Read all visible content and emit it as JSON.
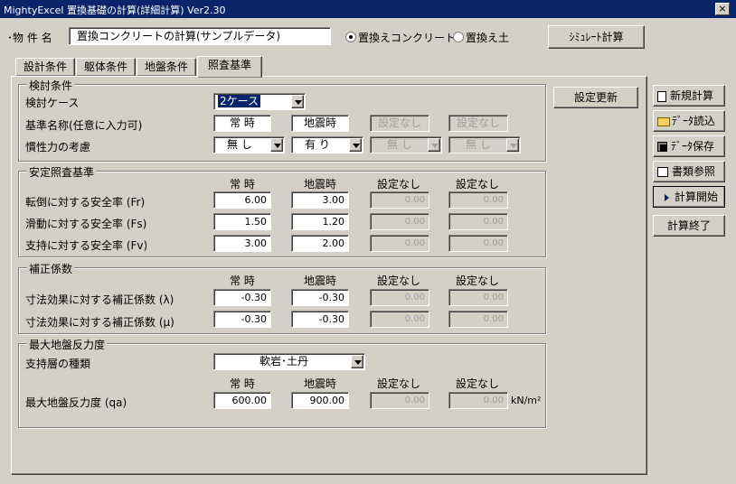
{
  "window": {
    "title": "MightyExcel 置換基礎の計算(詳細計算) Ver2.30",
    "close": "×"
  },
  "header": {
    "property_label": "･物 件 名",
    "property_value": "置換コンクリートの計算(サンプルデータ)",
    "radio1": "置換えコンクリート",
    "radio2": "置換え土",
    "simulate_button": "ｼﾐｭﾚｰﾄ計算"
  },
  "tabs": [
    "設計条件",
    "躯体条件",
    "地盤条件",
    "照査基準"
  ],
  "active_tab": "照査基準",
  "review_conditions": {
    "title": "検討条件",
    "case_label": "検討ケース",
    "case_value": "2ケース",
    "name_label": "基準名称(任意に入力可)",
    "names": [
      "常 時",
      "地震時",
      "設定なし",
      "設定なし"
    ],
    "inertia_label": "慣性力の考慮",
    "inertia": [
      "無 し",
      "有 り",
      "無 し",
      "無 し"
    ]
  },
  "update_button": "設定更新",
  "stability": {
    "title": "安定照査基準",
    "headers": [
      "常 時",
      "地震時",
      "設定なし",
      "設定なし"
    ],
    "rows": [
      {
        "label": "転倒に対する安全率 (Fr)",
        "values": [
          "6.00",
          "3.00",
          "0.00",
          "0.00"
        ]
      },
      {
        "label": "滑動に対する安全率 (Fs)",
        "values": [
          "1.50",
          "1.20",
          "0.00",
          "0.00"
        ]
      },
      {
        "label": "支持に対する安全率 (Fv)",
        "values": [
          "3.00",
          "2.00",
          "0.00",
          "0.00"
        ]
      }
    ]
  },
  "correction": {
    "title": "補正係数",
    "headers": [
      "常 時",
      "地震時",
      "設定なし",
      "設定なし"
    ],
    "rows": [
      {
        "label": "寸法効果に対する補正係数 (λ)",
        "values": [
          "-0.30",
          "-0.30",
          "0.00",
          "0.00"
        ]
      },
      {
        "label": "寸法効果に対する補正係数 (μ)",
        "values": [
          "-0.30",
          "-0.30",
          "0.00",
          "0.00"
        ]
      }
    ]
  },
  "max_reaction": {
    "title": "最大地盤反力度",
    "layer_label": "支持層の種類",
    "layer_value": "軟岩･土丹",
    "headers": [
      "常 時",
      "地震時",
      "設定なし",
      "設定なし"
    ],
    "row_label": "最大地盤反力度 (qa)",
    "values": [
      "600.00",
      "900.00",
      "0.00",
      "0.00"
    ],
    "unit": "kN/m²"
  },
  "sidebar": {
    "new": "新規計算",
    "load": "ﾃﾞｰﾀ読込",
    "save": "ﾃﾞｰﾀ保存",
    "docs": "書類参照",
    "start": "計算開始",
    "end": "計算終了"
  }
}
